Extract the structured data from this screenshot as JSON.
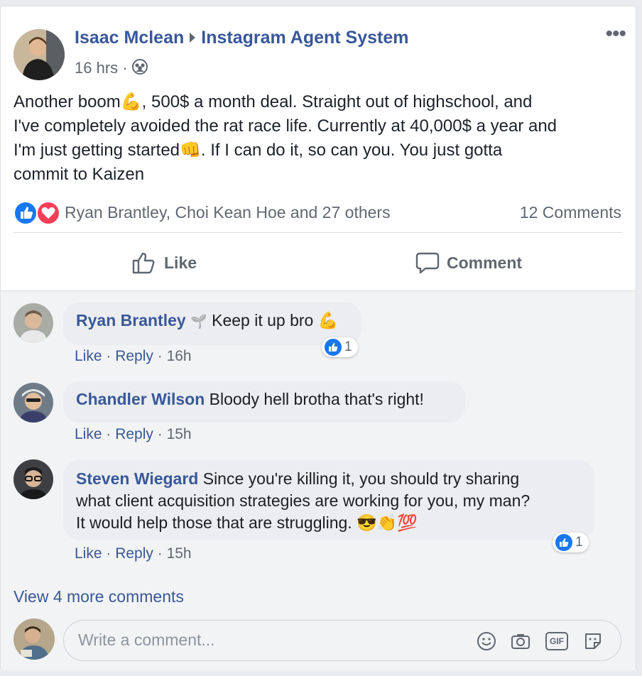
{
  "post": {
    "author": "Isaac Mclean",
    "group": "Instagram Agent System",
    "time": "16 hrs",
    "separator": "·",
    "text_line1": "Another boom",
    "emoji_muscle": "💪",
    "text_line1b": ", 500$ a month deal. Straight out of highschool, and",
    "text_line2": "I've completely avoided the rat race life. Currently at 40,000$ a year and",
    "text_line3": "I'm just getting started",
    "emoji_fist": "👊",
    "text_line3b": ". If I can do it, so can you. You just gotta",
    "text_line4": "commit to Kaizen",
    "reactions_text": "Ryan Brantley, Choi Kean Hoe and 27 others",
    "comments_count": "12 Comments"
  },
  "actions": {
    "like": "Like",
    "comment": "Comment"
  },
  "comments": [
    {
      "name": "Ryan Brantley",
      "badge": "🌱",
      "text": "Keep it up bro",
      "emoji": "💪",
      "like": "Like",
      "reply": "Reply",
      "time": "16h",
      "likes": "1"
    },
    {
      "name": "Chandler Wilson",
      "text": "Bloody hell brotha that's right!",
      "like": "Like",
      "reply": "Reply",
      "time": "15h"
    },
    {
      "name": "Steven Wiegard",
      "text_line1": "Since you're killing it, you should try sharing",
      "text_line2": "what client acquisition strategies are working for you, my man?",
      "text_line3": "It would help those that are struggling.",
      "emoji": "😎👏💯",
      "like": "Like",
      "reply": "Reply",
      "time": "15h",
      "likes": "1"
    }
  ],
  "view_more": "View 4 more comments",
  "composer": {
    "placeholder": "Write a comment...",
    "gif_label": "GIF"
  },
  "colors": {
    "link": "#385898",
    "like_blue": "#1877f2",
    "love_red": "#f33e58",
    "muted": "#616770"
  }
}
